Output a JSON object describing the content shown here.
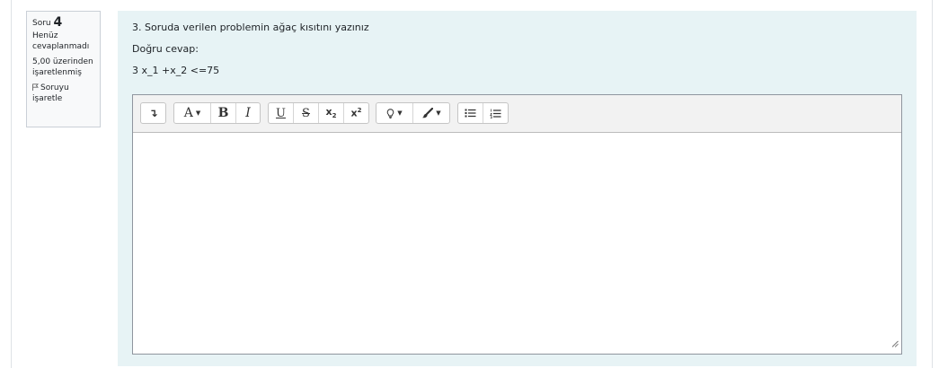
{
  "question_info": {
    "label": "Soru",
    "number": "4",
    "state": "Henüz cevaplanmadı",
    "grade": "5,00 üzerinden işaretlenmiş",
    "flag_label": "Soruyu işaretle"
  },
  "question": {
    "text": "3. Soruda verilen problemin ağaç kısıtını yazınız",
    "answer_label": "Doğru cevap:",
    "answer_text": "3 x_1 +x_2 <=75"
  },
  "editor": {
    "value": "",
    "toolbar": {
      "show_more": "↴",
      "font_style": "A",
      "bold": "B",
      "italic": "I",
      "underline": "U",
      "strike": "S",
      "subscript": "x",
      "subscript_suffix": "2",
      "superscript": "x",
      "superscript_suffix": "2"
    }
  }
}
